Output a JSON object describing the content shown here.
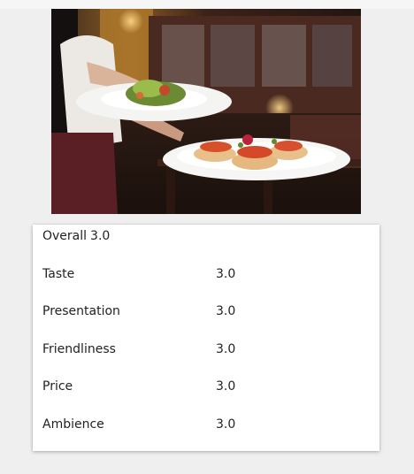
{
  "photo": {
    "alt": "Waiter carrying two plates of food in a restaurant"
  },
  "ratings": {
    "overall_label": "Overall",
    "overall_value": "3.0",
    "rows": [
      {
        "label": "Taste",
        "value": "3.0"
      },
      {
        "label": "Presentation",
        "value": "3.0"
      },
      {
        "label": "Friendliness",
        "value": "3.0"
      },
      {
        "label": "Price",
        "value": "3.0"
      },
      {
        "label": "Ambience",
        "value": "3.0"
      }
    ]
  }
}
